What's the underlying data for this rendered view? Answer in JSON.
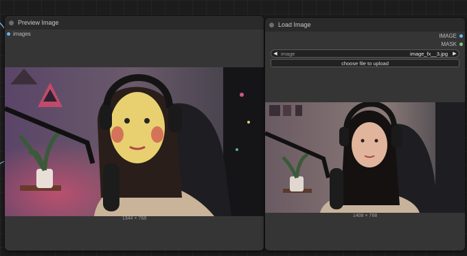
{
  "preview_node": {
    "title": "Preview Image",
    "input_label": "images",
    "image_size": "1344 × 768"
  },
  "load_node": {
    "title": "Load Image",
    "outputs": [
      "IMAGE",
      "MASK"
    ],
    "image_combo": {
      "label": "image",
      "value": "image_fx__3.jpg"
    },
    "upload_label": "choose file to upload",
    "image_size": "1408 × 768"
  },
  "colors": {
    "image_slot": "#64b5f6",
    "mask_slot": "#81c784",
    "node_body": "#353535",
    "node_title": "#2a2a2a"
  }
}
